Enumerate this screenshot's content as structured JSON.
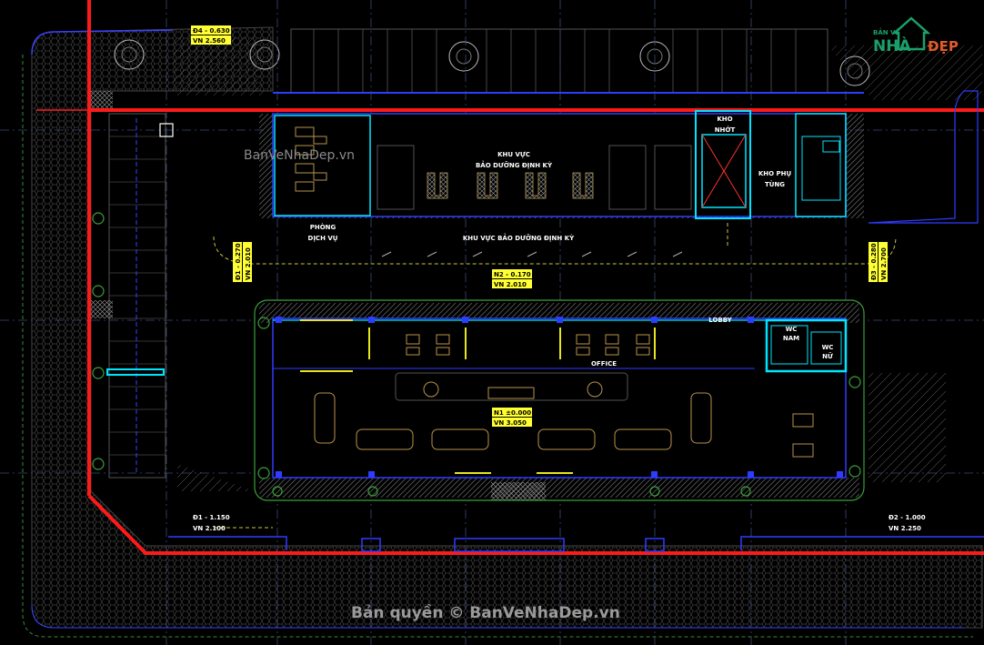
{
  "drawing": {
    "rooms": {
      "kho_nhot": [
        "KHO",
        "NHỚT"
      ],
      "kho_phu_tung": [
        "KHO PHỤ",
        "TÙNG"
      ],
      "khu_vuc_bao_duong_top": [
        "KHU VỰC",
        "BẢO DƯỠNG ĐỊNH KỲ"
      ],
      "khu_vuc_bao_duong_row": "KHU VỰC BẢO DƯỠNG ĐỊNH KỲ",
      "phong_dich_vu": [
        "PHÒNG",
        "DỊCH VỤ"
      ],
      "office": "OFFICE",
      "wc_nam": [
        "WC",
        "NAM"
      ],
      "wc_nu": [
        "WC",
        "NỮ"
      ],
      "lobby": "LOBBY"
    },
    "levels": {
      "n4": {
        "top": "Đ4 - 0.630",
        "bottom": "VN 2.560"
      },
      "n2": {
        "top": "N2 - 0.170",
        "bottom": "VN 2.010"
      },
      "n1": {
        "top": "N1 ±0.000",
        "bottom": "VN 3.050"
      },
      "d1_left": {
        "top": "Đ1 - 0.270",
        "bottom": "VN 2.010"
      },
      "d3_right": {
        "top": "Đ3 - 0.280",
        "bottom": "VN 2.700"
      },
      "d1_bottom": {
        "top": "Đ1 - 1.150",
        "bottom": "VN 2.100"
      },
      "d2_bottom": {
        "top": "Đ2 - 1.000",
        "bottom": "VN 2.250"
      }
    }
  },
  "watermark": {
    "top": "BanVeNhaDep.vn",
    "bottom": "Bản quyền © BanVeNhaDep.vn"
  },
  "logo": {
    "small": "BẢN VẼ",
    "nha": "NHÀ",
    "dep": "ĐẸP"
  },
  "colors": {
    "background": "#000000",
    "property_line": "#ff1a1a",
    "walls": "#2f3cff",
    "highlight": "#00e5ff",
    "paving": "#6d6d6d",
    "grid": "#4a5a8a",
    "level_tag": "#ffff33",
    "furniture": "#b8924a"
  }
}
